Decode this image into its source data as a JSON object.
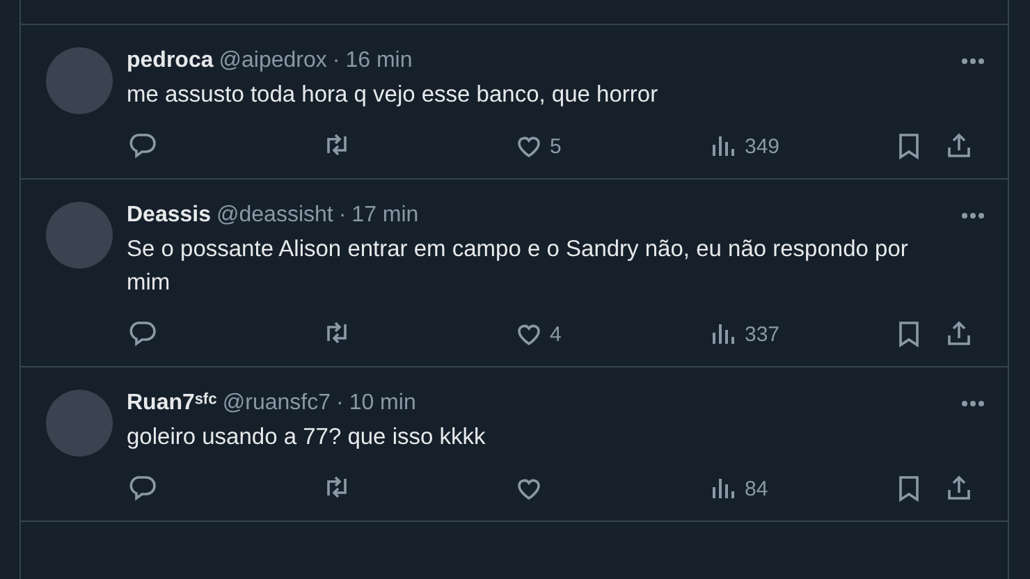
{
  "tweets": [
    {
      "name": "pedroca",
      "handle": "@aipedrox",
      "separator": "·",
      "time": "16 min",
      "text": "me assusto toda hora q vejo esse banco, que horror",
      "likes": "5",
      "views": "349"
    },
    {
      "name": "Deassis",
      "handle": "@deassisht",
      "separator": "·",
      "time": "17 min",
      "text": "Se o possante Alison entrar em campo e o Sandry não, eu não respondo por mim",
      "likes": "4",
      "views": "337"
    },
    {
      "name": "Ruan7ˢᶠᶜ",
      "handle": "@ruansfc7",
      "separator": "·",
      "time": "10 min",
      "text": "goleiro usando a 77? que isso kkkk",
      "views": "84"
    }
  ]
}
